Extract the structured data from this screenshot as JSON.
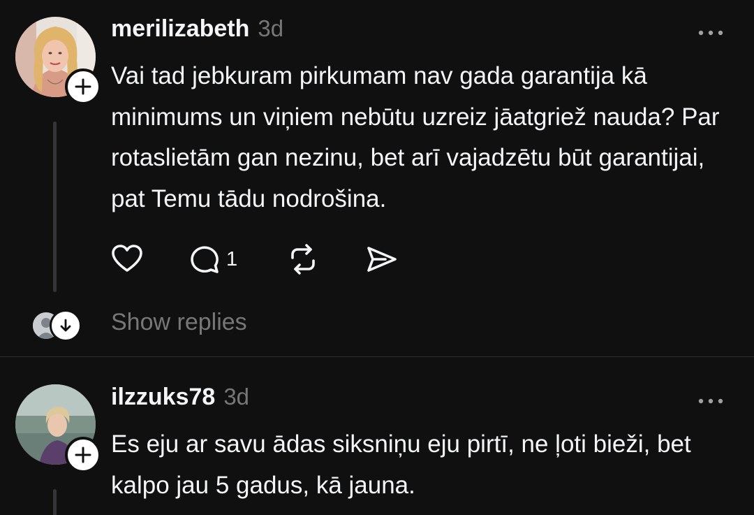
{
  "posts": [
    {
      "username": "merilizabeth",
      "time": "3d",
      "text": "Vai tad jebkuram pirkumam nav gada garantija kā minimums un viņiem nebūtu uzreiz jāatgriež nauda? Par rotaslietām gan nezinu, bet arī vajadzētu būt garantijai, pat Temu tādu nodrošina.",
      "avatar_icon": "user-photo",
      "actions": {
        "like_icon": "heart-icon",
        "reply_icon": "comment-icon",
        "reply_count": "1",
        "repost_icon": "repost-icon",
        "share_icon": "send-icon"
      },
      "show_replies": "Show replies"
    },
    {
      "username": "ilzzuks78",
      "time": "3d",
      "text": "Es eju ar savu ādas siksniņu eju pirtī, ne ļoti bieži, bet kalpo jau 5 gadus, kā jauna.",
      "avatar_icon": "user-photo"
    }
  ],
  "colors": {
    "background": "#101010",
    "text_primary": "#f3f5f7",
    "text_secondary": "#777777",
    "divider": "#2d2d2d",
    "thread_line": "#333638"
  }
}
